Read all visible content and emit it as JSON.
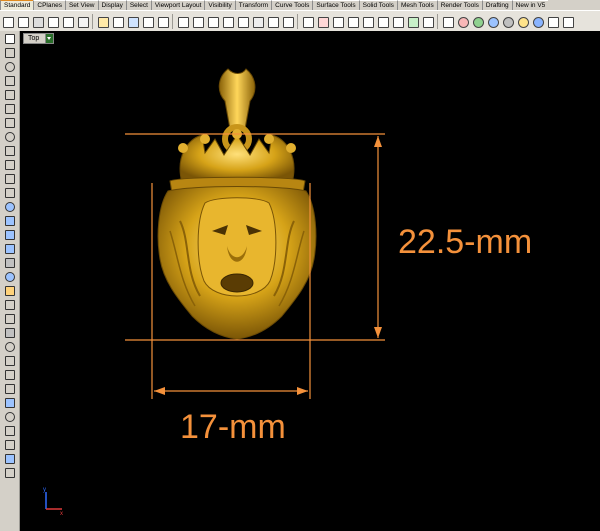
{
  "tabs": [
    "Standard",
    "CPlanes",
    "Set View",
    "Display",
    "Select",
    "Viewport Layout",
    "Visibility",
    "Transform",
    "Curve Tools",
    "Surface Tools",
    "Solid Tools",
    "Mesh Tools",
    "Render Tools",
    "Drafting",
    "New in V5"
  ],
  "active_tab": "Standard",
  "viewport": {
    "label": "Top"
  },
  "dimensions": {
    "height_label": "22.5-mm",
    "width_label": "17-mm"
  },
  "colors": {
    "dimension": "#f4913b",
    "viewport_bg": "#000000",
    "model": "#d6a318"
  },
  "axis": {
    "x": "x",
    "y": "y"
  }
}
